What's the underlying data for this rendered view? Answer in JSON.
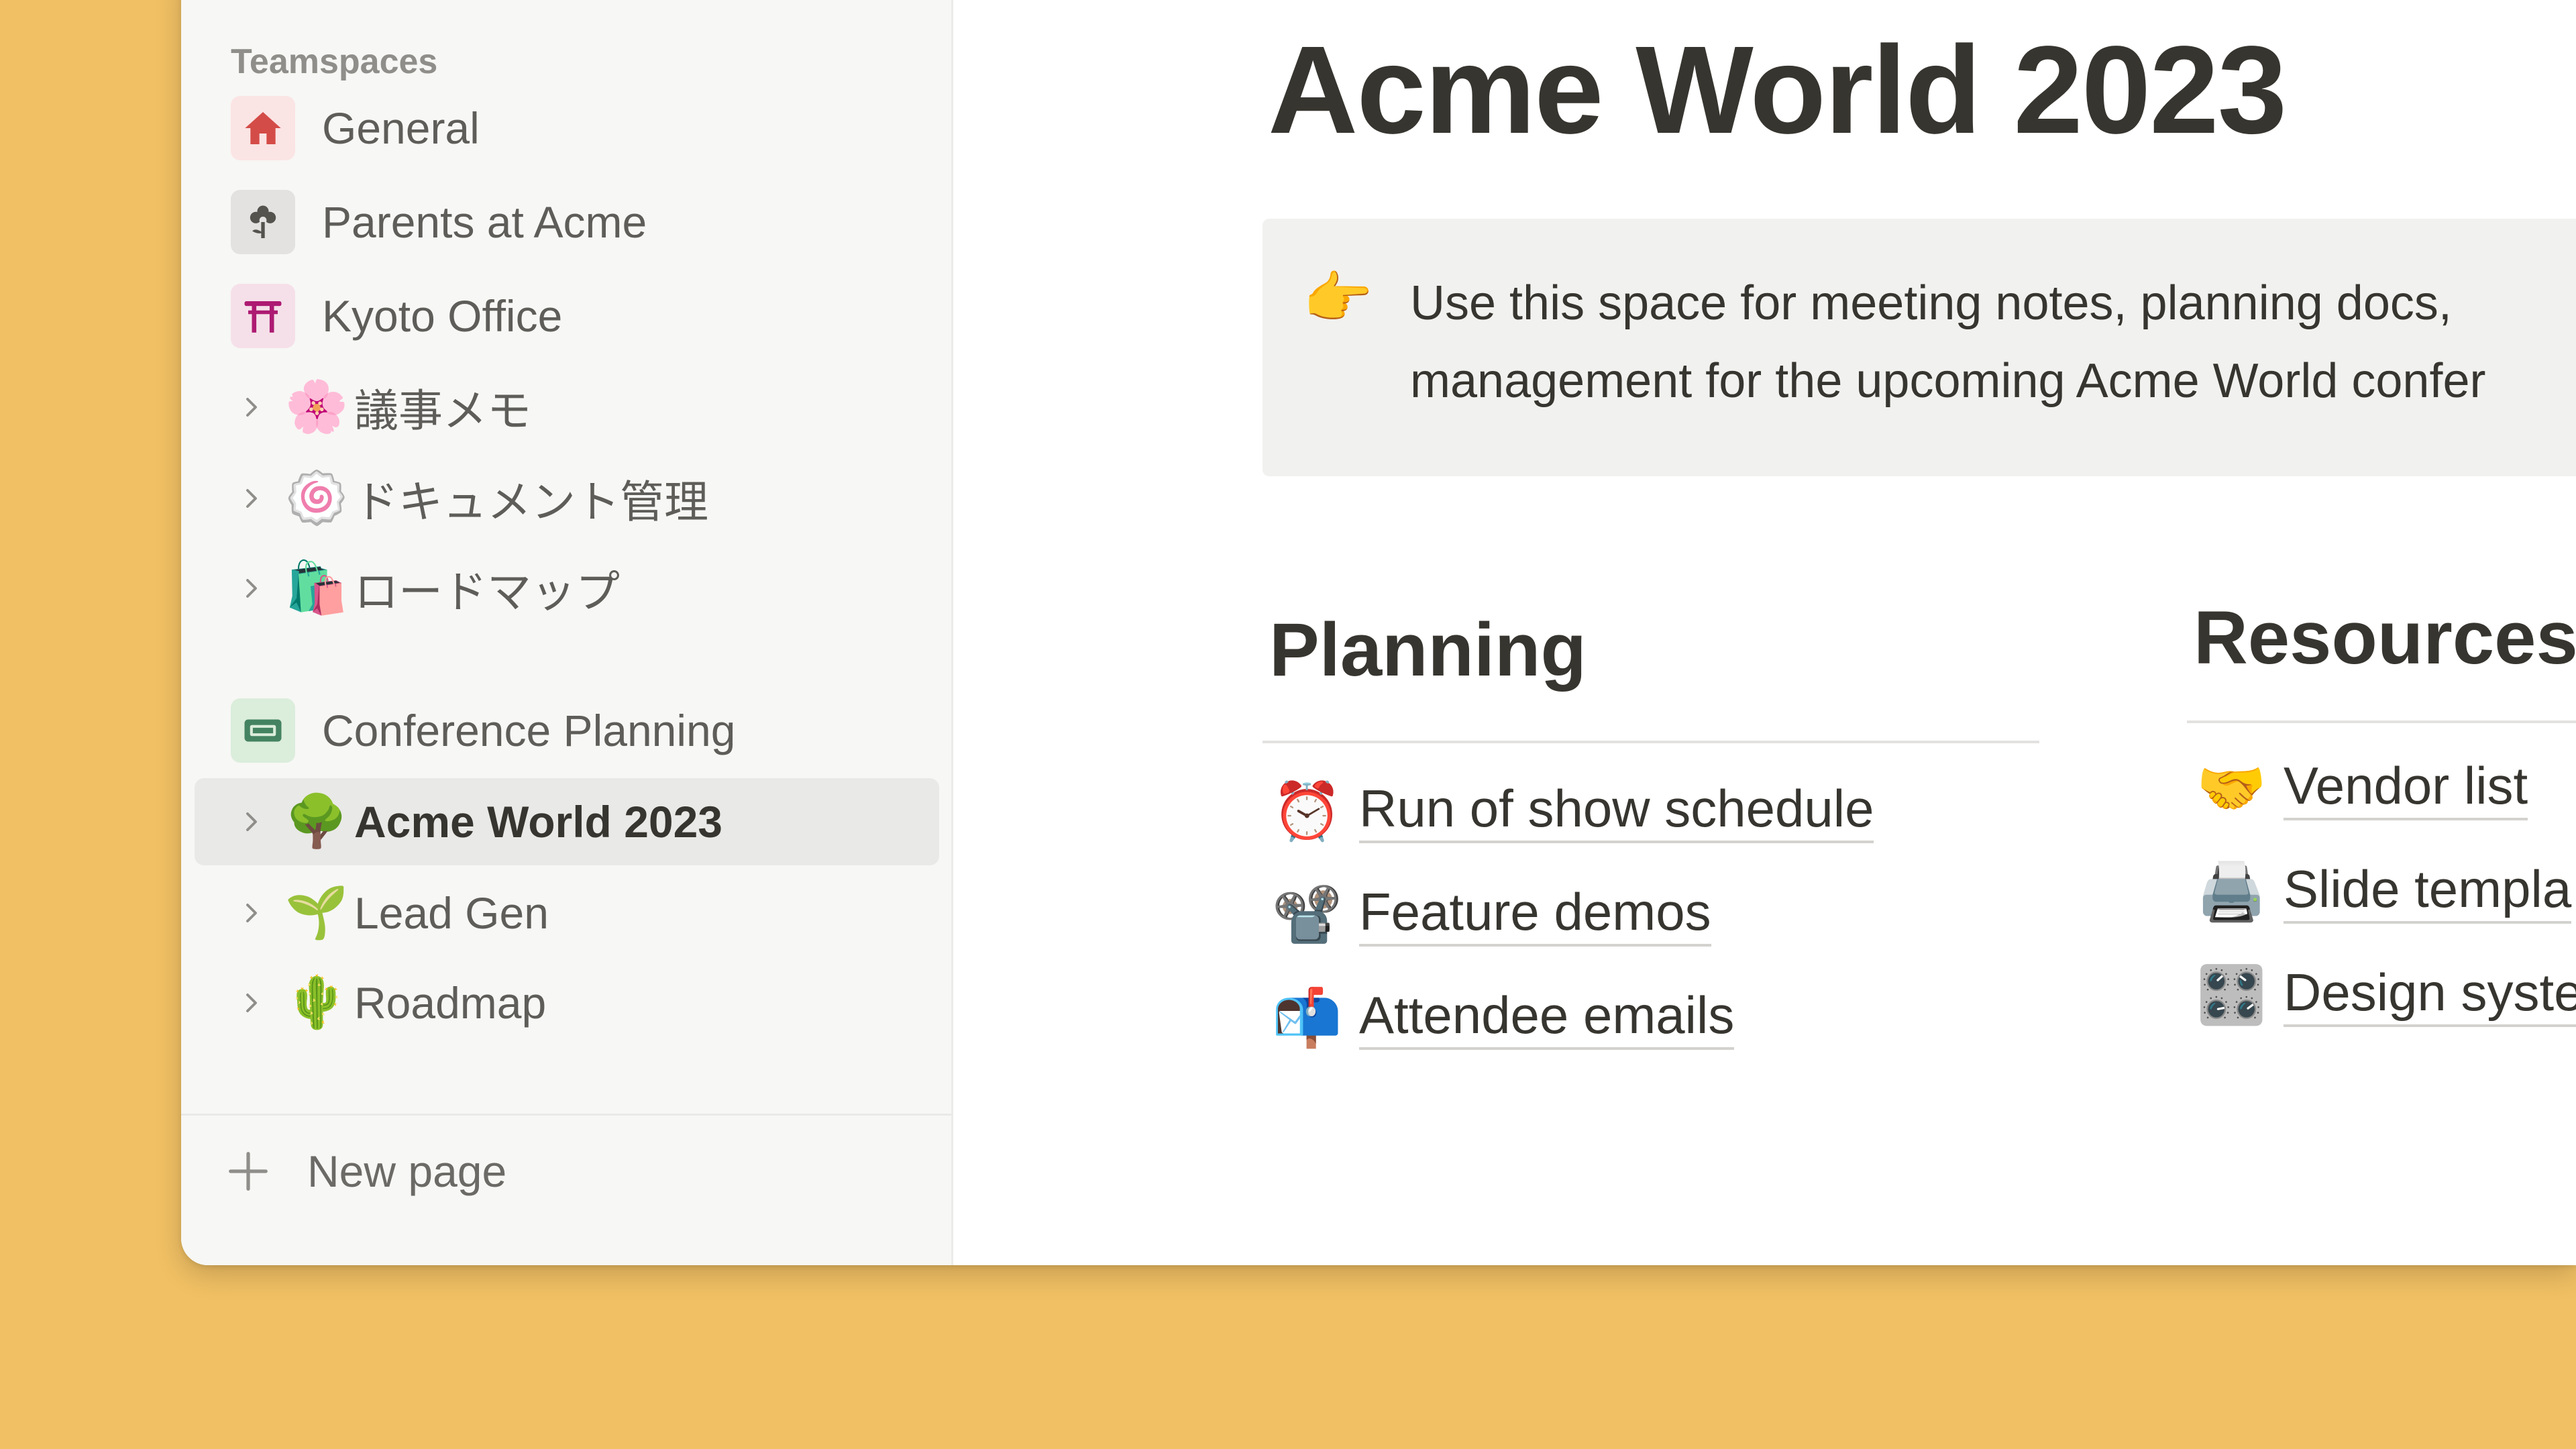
{
  "sidebar": {
    "section_label": "Teamspaces",
    "teamspaces": [
      {
        "label": "General",
        "icon": "house-icon"
      },
      {
        "label": "Parents at Acme",
        "icon": "flower-icon"
      },
      {
        "label": "Kyoto Office",
        "icon": "torii-gate-icon"
      }
    ],
    "kyoto_pages": [
      {
        "label": "議事メモ",
        "emoji": "🌸"
      },
      {
        "label": "ドキュメント管理",
        "emoji": "🍥"
      },
      {
        "label": "ロードマップ",
        "emoji": "🛍️"
      }
    ],
    "conference": {
      "label": "Conference Planning",
      "icon": "ticket-icon"
    },
    "conference_pages": [
      {
        "label": "Acme World 2023",
        "emoji": "🌳"
      },
      {
        "label": "Lead Gen",
        "emoji": "🌱"
      },
      {
        "label": "Roadmap",
        "emoji": "🌵"
      }
    ],
    "new_page_label": "New page"
  },
  "page": {
    "title": "Acme World 2023",
    "callout": {
      "emoji": "👉",
      "line1": "Use this space for meeting notes, planning docs,",
      "line2": "management for the upcoming Acme World confer"
    },
    "planning": {
      "heading": "Planning",
      "links": [
        {
          "emoji": "⏰",
          "label": "Run of show schedule"
        },
        {
          "emoji": "📽️",
          "label": "Feature demos"
        },
        {
          "emoji": "📬",
          "label": "Attendee emails"
        }
      ]
    },
    "resources": {
      "heading": "Resources",
      "links": [
        {
          "emoji": "🤝",
          "label": "Vendor list"
        },
        {
          "emoji": "🖨️",
          "label": "Slide templa"
        },
        {
          "emoji": "🎛️",
          "label": "Design syste"
        }
      ]
    }
  },
  "colors": {
    "background": "#f1c064",
    "sidebar_bg": "#f7f7f5",
    "active_item_bg": "#e9e9e7",
    "text_primary": "#37352f",
    "text_secondary": "#5e5d59",
    "callout_bg": "#f1f1ef"
  }
}
